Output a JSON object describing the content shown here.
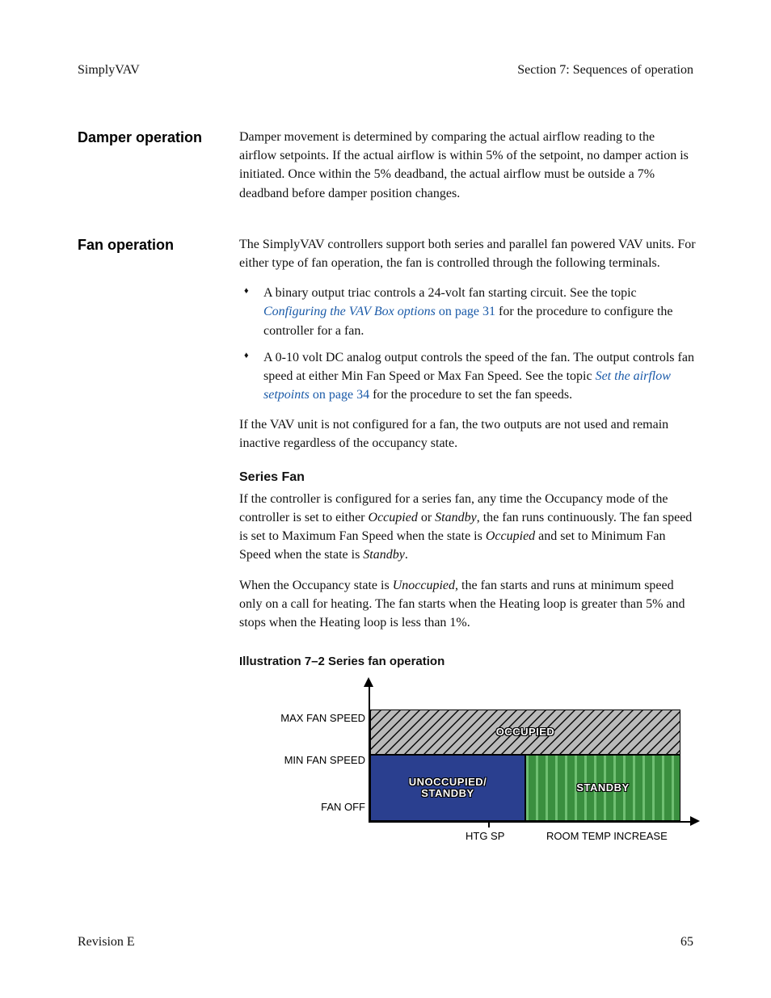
{
  "header": {
    "left": "SimplyVAV",
    "right": "Section 7: Sequences of operation"
  },
  "sections": {
    "damper": {
      "heading": "Damper operation",
      "para": "Damper movement is determined by comparing the actual airflow reading to the airflow setpoints. If the actual airflow is within 5% of the setpoint, no damper action is initiated. Once within the 5% deadband, the actual airflow must be outside a 7% deadband before damper position changes."
    },
    "fan": {
      "heading": "Fan operation",
      "intro": "The SimplyVAV controllers support both series and parallel fan powered VAV units. For either type of fan operation, the fan is controlled through the following terminals.",
      "bullet1_pre": "A binary output triac controls a 24-volt fan starting circuit. See the topic ",
      "bullet1_link_text": "Configuring the VAV Box options",
      "bullet1_link_page": " on page 31",
      "bullet1_post": " for the procedure to configure the controller for a fan.",
      "bullet2_pre": "A 0-10 volt DC analog output controls the speed of the fan. The output controls fan speed at either Min Fan Speed or Max Fan Speed. See the topic ",
      "bullet2_link_text": "Set the airflow setpoints",
      "bullet2_link_page": " on page 34",
      "bullet2_post": " for the procedure to set the fan speeds.",
      "after_list": "If the VAV unit is not configured for a fan, the two outputs are not used and remain inactive regardless of the occupancy state.",
      "series_heading": "Series Fan",
      "series_p1_a": "If the controller is configured for a series fan, any time the Occupancy mode of the controller is set to either ",
      "series_p1_occ": "Occupied",
      "series_p1_b": " or ",
      "series_p1_stb": "Standby",
      "series_p1_c": ", the fan runs continuously. The fan speed is set to Maximum Fan Speed when the state is ",
      "series_p1_occ2": "Occupied",
      "series_p1_d": " and set to Minimum Fan Speed when the state is ",
      "series_p1_stb2": "Standby",
      "series_p1_e": ".",
      "series_p2_a": "When the Occupancy state is ",
      "series_p2_unocc": "Unoccupied",
      "series_p2_b": ", the fan starts and runs at minimum speed only on a call for heating. The fan starts when the Heating loop is greater than 5% and stops when the Heating loop is less than 1%.",
      "figure_caption": "Illustration 7–2  Series fan operation"
    }
  },
  "chart_data": {
    "type": "area",
    "title": "Series fan operation",
    "ylabel_levels": [
      "MAX FAN SPEED",
      "MIN FAN SPEED",
      "FAN OFF"
    ],
    "x_tick_label": "HTG SP",
    "x_axis_label_right": "ROOM TEMP INCREASE",
    "regions": [
      {
        "name": "OCCUPIED",
        "y_from": "MIN FAN SPEED",
        "y_to": "MAX FAN SPEED",
        "x_from": "start",
        "x_to": "end",
        "color": "#b9b9b9",
        "pattern": "diagonal-hatch"
      },
      {
        "name": "UNOCCUPIED/\nSTANDBY",
        "y_from": "FAN OFF",
        "y_to": "MIN FAN SPEED",
        "x_from": "start",
        "x_to": "HTG SP",
        "color": "#2a3f8f",
        "pattern": "solid"
      },
      {
        "name": "STANDBY",
        "y_from": "FAN OFF",
        "y_to": "MIN FAN SPEED",
        "x_from": "HTG SP",
        "x_to": "end",
        "color": "#3a8f3f",
        "pattern": "vertical-stripes"
      }
    ],
    "region_labels": {
      "occupied": "OCCUPIED",
      "unocc": "UNOCCUPIED/\nSTANDBY",
      "standby": "STANDBY"
    }
  },
  "footer": {
    "left": "Revision E",
    "right": "65"
  }
}
